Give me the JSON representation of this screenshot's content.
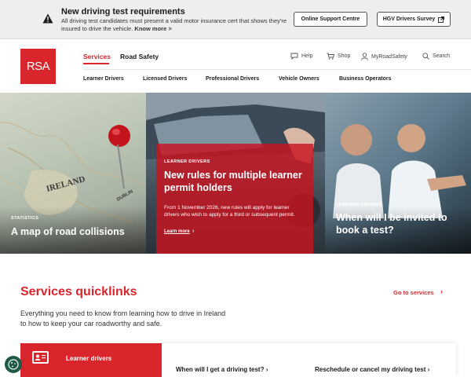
{
  "alert": {
    "title": "New driving test requirements",
    "body_text": "All driving test candidates must present a valid motor insurance cert that shows they're insured to drive the vehicle.",
    "know_more": "Know more >",
    "buttons": [
      {
        "label": "Online Support Centre"
      },
      {
        "label": "HGV Drivers Survey"
      }
    ]
  },
  "header": {
    "logo_text": "RSA",
    "main_nav": [
      {
        "label": "Services",
        "active": true
      },
      {
        "label": "Road Safety",
        "active": false
      }
    ],
    "utility_nav": [
      {
        "label": "Help",
        "icon": "chat-bubble-icon"
      },
      {
        "label": "Shop",
        "icon": "cart-icon"
      },
      {
        "label": "MyRoadSafety",
        "icon": "user-icon"
      },
      {
        "label": "Search",
        "icon": "search-icon"
      }
    ],
    "sub_nav": [
      {
        "label": "Learner Drivers"
      },
      {
        "label": "Licensed Drivers"
      },
      {
        "label": "Professional Drivers"
      },
      {
        "label": "Vehicle Owners"
      },
      {
        "label": "Business Operators"
      }
    ]
  },
  "hero": {
    "panels": [
      {
        "tag": "STATISTICS",
        "title": "A map of road collisions"
      },
      {
        "tag": "LEARNER DRIVERS",
        "title": "New rules for multiple learner permit holders",
        "body": "From 1 November 2026, new rules will apply for learner drivers who wish to apply for a third or subsequent permit.",
        "link": "Learn more"
      },
      {
        "tag": "LEARNER DRIVERS",
        "title": "When will I be invited to book a test?"
      }
    ],
    "map_labels": [
      "IRELAND",
      "DUBLIN"
    ]
  },
  "quicklinks": {
    "title": "Services quicklinks",
    "go_link": "Go to services",
    "description": "Everything you need to know from learning how to drive in Ireland to how to keep your car roadworthy and safe.",
    "cards": [
      {
        "label": "Learner drivers",
        "icon": "id-card-icon"
      }
    ],
    "links": [
      {
        "label": "When will I get a driving test?"
      },
      {
        "label": "Reschedule or cancel my driving test"
      }
    ]
  },
  "colors": {
    "brand_red": "#d9262c",
    "alert_bg": "#eeeeee",
    "cookie_green": "#1f5a46"
  }
}
